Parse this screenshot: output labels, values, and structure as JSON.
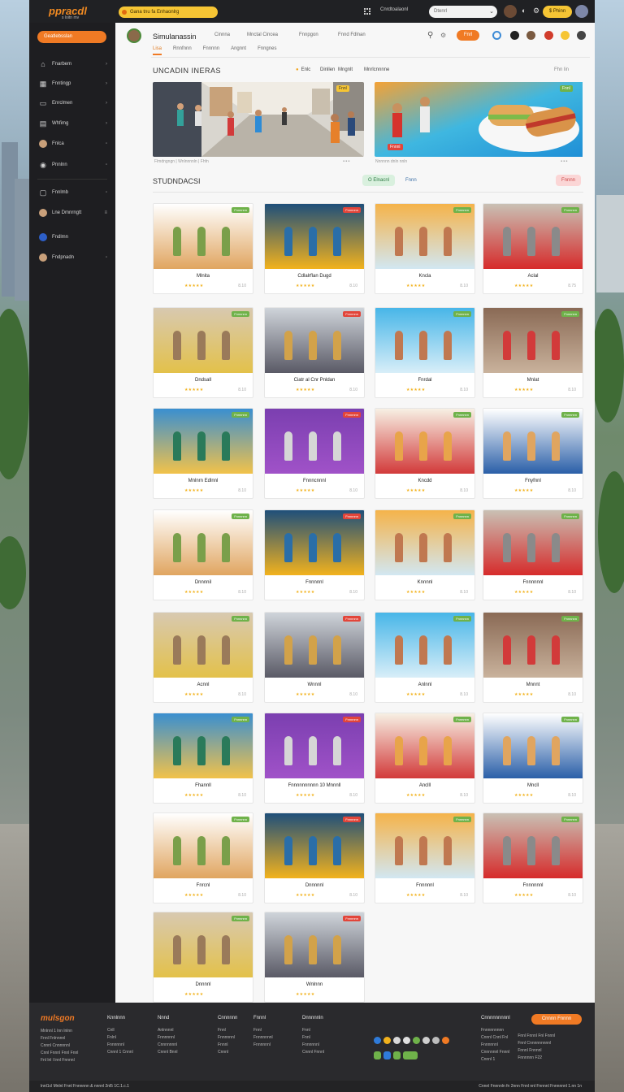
{
  "topbar": {
    "logo": "ppracdl",
    "logo_sub": "s loitn mv",
    "promo": "Gana tnu fa Enhaonlrg",
    "account": "Cnrdtoalaonl",
    "search_placeholder": "Dtenrl",
    "cta": "$ Phinn"
  },
  "sidebar": {
    "primary_button": "Geatlebsslan",
    "items": [
      {
        "label": "Fnarbem",
        "icon": "home-icon"
      },
      {
        "label": "Fnntingp",
        "icon": "grid-icon"
      },
      {
        "label": "Enrclmen",
        "icon": "calendar-icon"
      },
      {
        "label": "Whfimg",
        "icon": "chat-icon"
      },
      {
        "label": "Fnlca",
        "icon": "avatar"
      },
      {
        "label": "Pnnlnn",
        "icon": "globe-icon"
      },
      {
        "label": "Fnnlmb",
        "icon": "bag-icon"
      },
      {
        "label": "Lne Dmnrngtt",
        "icon": "avatar"
      },
      {
        "label": "Fndlmn",
        "icon": "avatar-blue"
      },
      {
        "label": "Fndpnadn",
        "icon": "avatar"
      }
    ]
  },
  "header": {
    "title": "Simulanassin",
    "nav": [
      "Cinnna",
      "Mnctal Cincea",
      "Fnnpgon",
      "Fnnd Fdlnan"
    ],
    "button": "Fnrl",
    "subtabs": [
      "Lisa",
      "Rnnfnnn",
      "Fnnnnn",
      "Angnnt",
      "Fnngnes"
    ]
  },
  "featured": {
    "title": "UNCADIN INERAS",
    "filters": [
      "Enlc",
      "Dinllen",
      "Mngnlt",
      "Mnrlcnnnne"
    ],
    "right": "Fhn lin",
    "left_meta": "Flmdngngn  |  Wnlnnnnln  |  Fhfn",
    "right_meta": "Nnnnnn dnln nnln",
    "left_caption": "Mnlnnnnl",
    "right_caption": "Fnnnl",
    "left_badge": "Fnnl",
    "right_badge": "Fnnl"
  },
  "section": {
    "title": "STUDNDACSI",
    "btn_green": "O Elnacnl",
    "btn_blue": "Fnnn",
    "btn_red": "Fnnnn"
  },
  "cards": [
    {
      "title": "Mlnita",
      "badge": "Fnnnnnn",
      "meta": "8.10"
    },
    {
      "title": "Cdlalrflan Dugd",
      "badge": "Fnnnnnn",
      "meta": "8.10"
    },
    {
      "title": "Kncla",
      "badge": "Fnnnnnn",
      "meta": "8.10"
    },
    {
      "title": "Aclal",
      "badge": "Fnnnnnn",
      "meta": "8.75"
    },
    {
      "title": "Dndsall",
      "badge": "Fnnnnnn",
      "meta": "8.10"
    },
    {
      "title": "Ciatr al Cnr Pnldan",
      "badge": "Fnnnnnn",
      "meta": "8.10"
    },
    {
      "title": "Fnrdal",
      "badge": "Fnnnnnn",
      "meta": "8.10"
    },
    {
      "title": "Mnlat",
      "badge": "Fnnnnnn",
      "meta": "8.10"
    },
    {
      "title": "Mnlnrn Edlnnl",
      "badge": "Fnnnnnn",
      "meta": "8.10"
    },
    {
      "title": "Fnnncnnnl",
      "badge": "Fnnnnnn",
      "meta": "8.10"
    },
    {
      "title": "Kncdd",
      "badge": "Fnnnnnn",
      "meta": "8.10"
    },
    {
      "title": "Fnyfnnl",
      "badge": "Fnnnnnn",
      "meta": "8.10"
    },
    {
      "title": "Dnnnnil",
      "badge": "Fnnnnnn",
      "meta": "8.10"
    },
    {
      "title": "Fnnnnnl",
      "badge": "Fnnnnnn",
      "meta": "8.10"
    },
    {
      "title": "Knnnnl",
      "badge": "Fnnnnnn",
      "meta": "8.10"
    },
    {
      "title": "Fnnnnnnl",
      "badge": "Fnnnnnn",
      "meta": "8.10"
    },
    {
      "title": "Acnnl",
      "badge": "Fnnnnnn",
      "meta": "8.10"
    },
    {
      "title": "Wnnnl",
      "badge": "Fnnnnnn",
      "meta": "8.10"
    },
    {
      "title": "Anlnnl",
      "badge": "Fnnnnnn",
      "meta": "8.10"
    },
    {
      "title": "Mnnnt",
      "badge": "Fnnnnnn",
      "meta": "8.10"
    },
    {
      "title": "Fhannll",
      "badge": "Fnnnnnn",
      "meta": "8.10"
    },
    {
      "title": "Fnnnnnnnnnn 10 Mnnnll",
      "badge": "Fnnnnnn",
      "meta": "8.10"
    },
    {
      "title": "Anclll",
      "badge": "Fnnnnnn",
      "meta": "8.10"
    },
    {
      "title": "Mncll",
      "badge": "Fnnnnnn",
      "meta": "8.10"
    },
    {
      "title": "Fnrcnl",
      "badge": "Fnnnnnn",
      "meta": "8.10"
    },
    {
      "title": "Dnnnnnl",
      "badge": "Fnnnnnn",
      "meta": "8.10"
    },
    {
      "title": "Fnnnnnl",
      "badge": "Fnnnnnn",
      "meta": "8.10"
    },
    {
      "title": "Fnnnnnnl",
      "badge": "Fnnnnnn",
      "meta": "8.10"
    },
    {
      "title": "Dnnnnl",
      "badge": "Fnnnnnn",
      "meta": ""
    },
    {
      "title": "Wnlnnn",
      "badge": "Fnnnnnn",
      "meta": ""
    }
  ],
  "footer": {
    "logo": "mulsgon",
    "cols": [
      {
        "head": "Knnlnnn",
        "links": [
          "Cnll",
          "Fnlnl",
          "Fnnnnnnl",
          "Cnnnl 1 Cnnnl"
        ]
      },
      {
        "head": "Nnnd",
        "links": [
          "Anlnnnnl",
          "Fnnnnnnl",
          "Cnnnnnnnl",
          "Cnnnl Bnnl"
        ]
      },
      {
        "head": "Cnnnnnn",
        "links": [
          "Fnnl",
          "Fnnnnnnl",
          "Fnnnl",
          "Cnnnl"
        ]
      },
      {
        "head": "Fnnnl",
        "links": [
          "Fnnl",
          "Fnnnnnnnl",
          "Fnnnnnnl"
        ]
      },
      {
        "head": "Dnnnnnln",
        "links": [
          "Fnnl",
          "Fnnl",
          "Fnnnnnnl",
          "Cnnnl Fnnnl"
        ]
      }
    ],
    "left_links": [
      "Mnlnnl 1 lnn lnlnn",
      "Fnnl Fnlnnnnl",
      "Cnnnl Cnnnnnnl",
      "Cnnl Fnnnl Fnnl Fnnl",
      "Fnl lnl l lnnl Fnnnnl"
    ],
    "contact_head": "Cnnnnnnnnnl",
    "contact_links": [
      "Fnnnnnnnnn",
      "Cnnnl Cnnl Fnl",
      "Fnnnnnnl",
      "Cnnnnnnl Fnnnl",
      "Cnnnl 1"
    ],
    "contact_right": [
      "Fnnl Fnnnl Fnl Fnnnl",
      "Fnnl Cnnnnnnnnnl",
      "Fnnnl Fnnnnl",
      "Fnnnnnn  F22"
    ],
    "cta": "Cnnnn Fnnnn",
    "bottom_left": "lnnl1cl Mnlnl  Fnnl Fnnnnnn & nnnnl 2nl5 1C.1.c.1",
    "bottom_right": "Cnnnl Fnnnnln fn 2nnn Fnnl nnl Fnnnnl Fnnnnnnl 1.nn 1n"
  },
  "colors": {
    "accent": "#f07a24",
    "yellow": "#f6c534",
    "green": "#6fb24a",
    "red": "#e2453a",
    "dark": "#1f1f22"
  }
}
